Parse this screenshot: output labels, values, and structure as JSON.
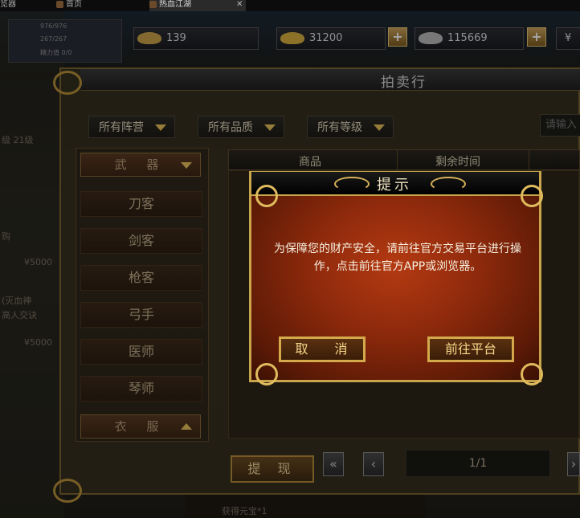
{
  "browser": {
    "tabs": [
      {
        "label": "览器"
      },
      {
        "label": "首页"
      },
      {
        "label": "热血江湖"
      }
    ],
    "close_glyph": "✕"
  },
  "player": {
    "lines": [
      "976/976",
      "267/267",
      "精力值 0/0"
    ]
  },
  "currencies": [
    {
      "value": "139",
      "icon": "gold-ingot-icon",
      "color": "#c9a24a"
    },
    {
      "value": "31200",
      "icon": "gold-bar-icon",
      "color": "#d8b040"
    },
    {
      "value": "115669",
      "icon": "silver-ingot-icon",
      "color": "#b8b8b8"
    },
    {
      "value": "¥",
      "icon": "yuan-icon",
      "color": "#ffffff"
    }
  ],
  "plus_glyph": "+",
  "auction": {
    "title": "拍卖行",
    "filters": [
      "所有阵营",
      "所有品质",
      "所有等级"
    ],
    "search_placeholder": "请输入",
    "categories_expanded": {
      "label": "武  器"
    },
    "categories": [
      "刀客",
      "剑客",
      "枪客",
      "弓手",
      "医师",
      "琴师"
    ],
    "categories_collapsed": {
      "label": "衣  服"
    },
    "columns": [
      "商品",
      "剩余时间"
    ],
    "withdraw_label": "提  现",
    "first_page_glyph": "«",
    "prev_page_glyph": "‹",
    "page_indicator": "1/1",
    "next_page_glyph": "›"
  },
  "background_text": {
    "left1": "级 21级",
    "left2": "购",
    "left3": "¥5000",
    "left4": "(灭血神",
    "left5": "高人交诀",
    "left6": "¥5000",
    "bottom1": "获得元宝*1"
  },
  "modal": {
    "title": "提示",
    "message": "为保障您的财产安全，请前往官方交易平台进行操作，点击前往官方APP或浏览器。",
    "cancel_label": "取 消",
    "goto_label": "前往平台"
  }
}
